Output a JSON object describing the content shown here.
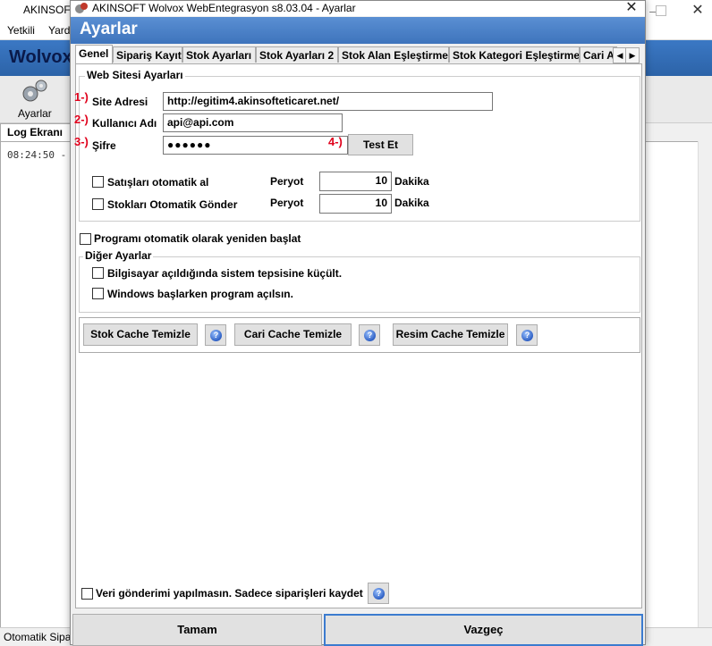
{
  "background_app": {
    "title": "AKINSOFT",
    "menu": [
      "Yetkili",
      "Yardı"
    ],
    "banner": "Wolvox",
    "toolbar_button": "Ayarlar",
    "log_tab": "Log Ekranı",
    "log_line": "08:24:50  -",
    "status": "Otomatik Sipa"
  },
  "dialog": {
    "title": "AKINSOFT Wolvox WebEntegrasyon s8.03.04 - Ayarlar",
    "header": "Ayarlar",
    "close_glyph": "✕",
    "tabs": [
      "Genel",
      "Sipariş Kayıt",
      "Stok Ayarları",
      "Stok Ayarları 2",
      "Stok Alan Eşleştirme",
      "Stok Kategori Eşleştirme",
      "Cari Ay"
    ],
    "active_tab": "Genel",
    "tab_scroll": [
      "◀",
      "▶"
    ]
  },
  "web_settings": {
    "group_label": "Web Sitesi Ayarları",
    "site_label": "Site Adresi",
    "site_value": "http://egitim4.akinsofteticaret.net/",
    "user_label": "Kullanıcı Adı",
    "user_value": "api@api.com",
    "password_label": "Şifre",
    "password_value": "●●●●●●",
    "test_button": "Test Et",
    "auto_sales_label": "Satışları otomatik al",
    "auto_sales_checked": false,
    "auto_stock_label": "Stokları Otomatik Gönder",
    "auto_stock_checked": false,
    "period_label_1": "Peryot",
    "period_value_1": "10",
    "period_unit_1": "Dakika",
    "period_label_2": "Peryot",
    "period_value_2": "10",
    "period_unit_2": "Dakika"
  },
  "annotations": [
    "1-)",
    "2-)",
    "3-)",
    "4-)"
  ],
  "auto_restart_label": "Programı otomatik olarak yeniden başlat",
  "other_settings": {
    "group_label": "Diğer Ayarlar",
    "tray_label": "Bilgisayar açıldığında sistem tepsisine küçült.",
    "startup_label": "Windows başlarken program açılsın."
  },
  "cache_buttons": {
    "stock": "Stok Cache Temizle",
    "customer": "Cari Cache Temizle",
    "image": "Resim Cache Temizle"
  },
  "no_send_label": "Veri gönderimi yapılmasın. Sadece siparişleri kaydet",
  "footer": {
    "ok": "Tamam",
    "cancel": "Vazgeç"
  },
  "colors": {
    "header_blue": "#3e74bc",
    "annotation_red": "#e0001b",
    "focus_blue": "#3b7bcf"
  }
}
